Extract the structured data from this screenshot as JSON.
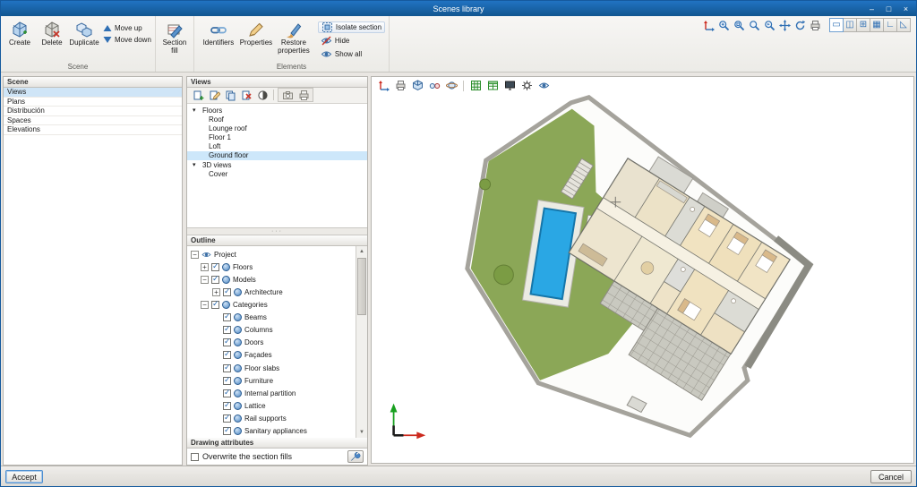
{
  "window": {
    "title": "Scenes library",
    "controls": {
      "minimize": "–",
      "maximize": "□",
      "close": "×"
    }
  },
  "ribbon": {
    "scene": {
      "label": "Scene",
      "create": "Create",
      "delete": "Delete",
      "duplicate": "Duplicate",
      "move_up": "Move up",
      "move_down": "Move down"
    },
    "section_fill": "Section fill",
    "elements": {
      "label": "Elements",
      "identifiers": "Identifiers",
      "properties": "Properties",
      "restore_properties": "Restore properties",
      "isolate_section": "Isolate section",
      "hide": "Hide",
      "show_all": "Show all"
    }
  },
  "scene_panel": {
    "title": "Scene",
    "items": [
      {
        "label": "Views",
        "selected": true
      },
      {
        "label": "Plans",
        "selected": false
      },
      {
        "label": "Distribución",
        "selected": false
      },
      {
        "label": "Spaces",
        "selected": false
      },
      {
        "label": "Elevations",
        "selected": false
      }
    ]
  },
  "views_panel": {
    "title": "Views",
    "floors_group": "Floors",
    "floors": [
      {
        "label": "Roof",
        "selected": false
      },
      {
        "label": "Lounge roof",
        "selected": false
      },
      {
        "label": "Floor 1",
        "selected": false
      },
      {
        "label": "Loft",
        "selected": false
      },
      {
        "label": "Ground floor",
        "selected": true
      }
    ],
    "views3d_group": "3D views",
    "views3d": [
      {
        "label": "Cover",
        "selected": false
      }
    ]
  },
  "outline_panel": {
    "title": "Outline",
    "root": "Project",
    "nodes": [
      {
        "label": "Floors",
        "checked": true
      },
      {
        "label": "Models",
        "checked": true
      },
      {
        "label": "Architecture",
        "checked": true
      },
      {
        "label": "Categories",
        "checked": true
      },
      {
        "label": "Beams",
        "checked": true
      },
      {
        "label": "Columns",
        "checked": true
      },
      {
        "label": "Doors",
        "checked": true
      },
      {
        "label": "Façades",
        "checked": true
      },
      {
        "label": "Floor slabs",
        "checked": true
      },
      {
        "label": "Furniture",
        "checked": true
      },
      {
        "label": "Internal partition",
        "checked": true
      },
      {
        "label": "Lattice",
        "checked": true
      },
      {
        "label": "Rail supports",
        "checked": true
      },
      {
        "label": "Sanitary appliances",
        "checked": true
      }
    ]
  },
  "drawing_attributes": {
    "title": "Drawing attributes",
    "overwrite_label": "Overwrite the section fills",
    "overwrite_checked": false
  },
  "footer": {
    "accept": "Accept",
    "cancel": "Cancel"
  },
  "plan_colors": {
    "garden": "#8ba757",
    "pool_water": "#2aa7e4",
    "roof": "#dadad4",
    "boundary_wall": "#a5a39c",
    "house_floor": "#f0e9d7",
    "axis_x": "#cc2a1e",
    "axis_y": "#18a01f"
  }
}
